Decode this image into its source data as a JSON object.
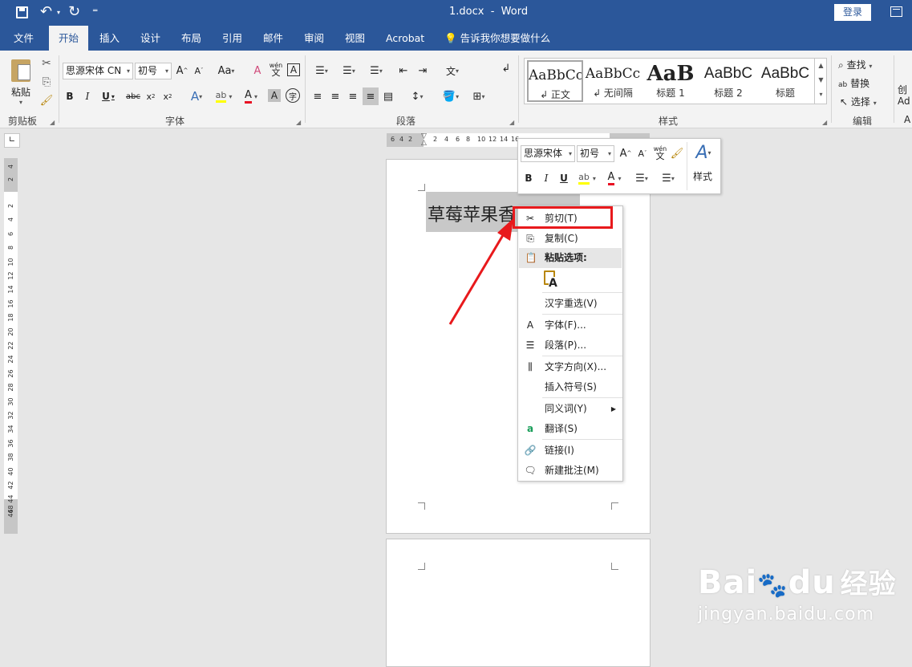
{
  "window": {
    "title": "1.docx  -  Word",
    "login": "登录"
  },
  "tabs": [
    "文件",
    "开始",
    "插入",
    "设计",
    "布局",
    "引用",
    "邮件",
    "审阅",
    "视图",
    "Acrobat"
  ],
  "tellme": "告诉我你想要做什么",
  "ribbon": {
    "clipboard": {
      "paste": "粘贴",
      "label": "剪贴板"
    },
    "font": {
      "name": "思源宋体 CN",
      "size": "初号",
      "label": "字体",
      "aa": "Aa",
      "wen": "wén",
      "wen2": "文"
    },
    "paragraph": {
      "label": "段落"
    },
    "styles": {
      "label": "样式",
      "items": [
        {
          "preview": "AaBbCc",
          "name": "↲ 正文"
        },
        {
          "preview": "AaBbCc",
          "name": "↲ 无间隔"
        },
        {
          "preview": "AaB",
          "name": "标题 1"
        },
        {
          "preview": "AaBbC",
          "name": "标题 2"
        },
        {
          "preview": "AaBbC",
          "name": "标题"
        }
      ]
    },
    "editing": {
      "find": "查找",
      "replace": "替换",
      "select": "选择",
      "label": "编辑"
    },
    "extra": {
      "create": "创",
      "ad": "Ad",
      "a": "A"
    }
  },
  "ruler": {
    "h": [
      "6",
      "4",
      "2",
      "2",
      "4",
      "6",
      "8",
      "10",
      "12",
      "14",
      "16"
    ],
    "v": [
      "4",
      "2",
      "2",
      "4",
      "6",
      "8",
      "10",
      "12",
      "14",
      "16",
      "18",
      "20",
      "22",
      "24",
      "26",
      "28",
      "30",
      "32",
      "34",
      "36",
      "38",
      "40",
      "42",
      "44",
      "46",
      "48"
    ]
  },
  "document": {
    "text": "草莓苹果香"
  },
  "minitoolbar": {
    "font": "思源宋体",
    "size": "初号",
    "styles": "样式",
    "wen": "wén",
    "wen2": "文"
  },
  "context_menu": {
    "items": [
      {
        "label": "剪切(T)"
      },
      {
        "label": "复制(C)"
      },
      {
        "label": "粘贴选项:"
      },
      {
        "label": "汉字重选(V)"
      },
      {
        "label": "字体(F)..."
      },
      {
        "label": "段落(P)..."
      },
      {
        "label": "文字方向(X)..."
      },
      {
        "label": "插入符号(S)"
      },
      {
        "label": "同义词(Y)"
      },
      {
        "label": "翻译(S)"
      },
      {
        "label": "链接(I)"
      },
      {
        "label": "新建批注(M)"
      }
    ]
  },
  "watermark": {
    "brand": "Bai",
    "brand2": "du",
    "cn": "经验",
    "url": "jingyan.baidu.com"
  },
  "colors": {
    "accent": "#2b579a",
    "highlight_box": "#e8191c",
    "arrow": "#e8191c",
    "font_red": "#e81123",
    "marker_yellow": "#ffff00"
  }
}
